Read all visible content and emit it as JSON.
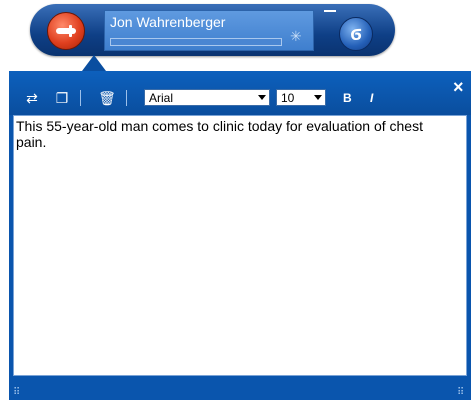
{
  "user_bar": {
    "user_name": "Jon Wahrenberger"
  },
  "icons": {
    "microphone": "microphone-icon",
    "spinner": "spinner-icon",
    "dragon": "dragon-icon",
    "transfer": "transfer-icon",
    "copy": "copy-icon",
    "trash": "trash-icon",
    "close": "close-icon"
  },
  "toolbar": {
    "font_value": "Arial",
    "size_value": "10",
    "bold_label": "B",
    "italic_label": "I",
    "close_label": "×"
  },
  "document": {
    "text": "This 55-year-old man comes to clinic today for evaluation of chest pain."
  },
  "colors": {
    "accent_blue": "#0a55ad",
    "mic_red": "#e0401f"
  }
}
